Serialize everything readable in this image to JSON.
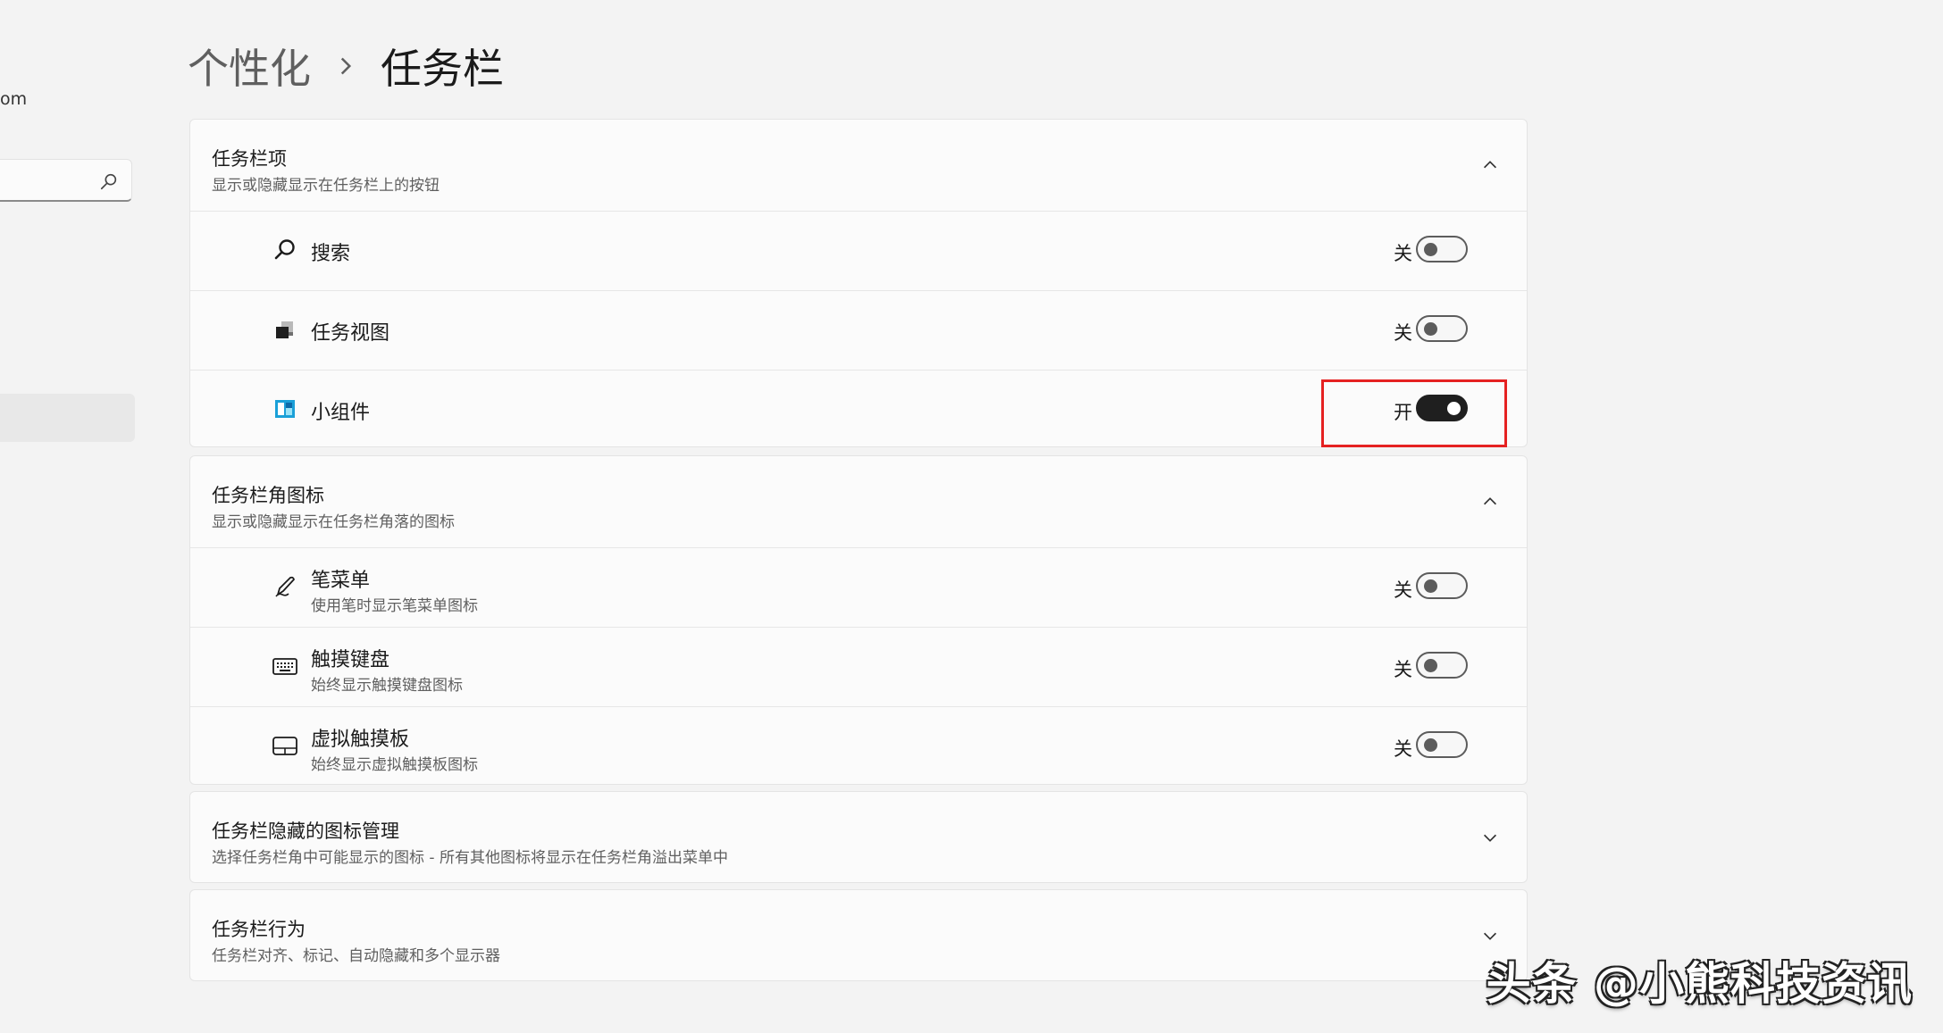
{
  "nav": {
    "email_fragment": "om",
    "search_icon": "search-icon"
  },
  "breadcrumb": {
    "parent": "个性化",
    "current": "任务栏"
  },
  "sections": {
    "taskbar_items": {
      "title": "任务栏项",
      "subtitle": "显示或隐藏显示在任务栏上的按钮",
      "expanded": true,
      "rows": [
        {
          "icon": "search-icon",
          "label": "搜索",
          "state": "关",
          "on": false
        },
        {
          "icon": "task-view-icon",
          "label": "任务视图",
          "state": "关",
          "on": false
        },
        {
          "icon": "widgets-icon",
          "label": "小组件",
          "state": "开",
          "on": true
        }
      ]
    },
    "corner_icons": {
      "title": "任务栏角图标",
      "subtitle": "显示或隐藏显示在任务栏角落的图标",
      "expanded": true,
      "rows": [
        {
          "icon": "pen-icon",
          "label": "笔菜单",
          "sublabel": "使用笔时显示笔菜单图标",
          "state": "关",
          "on": false
        },
        {
          "icon": "keyboard-icon",
          "label": "触摸键盘",
          "sublabel": "始终显示触摸键盘图标",
          "state": "关",
          "on": false
        },
        {
          "icon": "touchpad-icon",
          "label": "虚拟触摸板",
          "sublabel": "始终显示虚拟触摸板图标",
          "state": "关",
          "on": false
        }
      ]
    },
    "hidden_icons": {
      "title": "任务栏隐藏的图标管理",
      "subtitle": "选择任务栏角中可能显示的图标 - 所有其他图标将显示在任务栏角溢出菜单中",
      "expanded": false
    },
    "behaviors": {
      "title": "任务栏行为",
      "subtitle": "任务栏对齐、标记、自动隐藏和多个显示器",
      "expanded": false
    }
  },
  "bottom_cut_text": "",
  "watermark": "头条 @小熊科技资讯",
  "colors": {
    "toggle_on": "#1f1f1f",
    "highlight_box": "#e52121",
    "widgets_icon": "#1aa0d8"
  }
}
